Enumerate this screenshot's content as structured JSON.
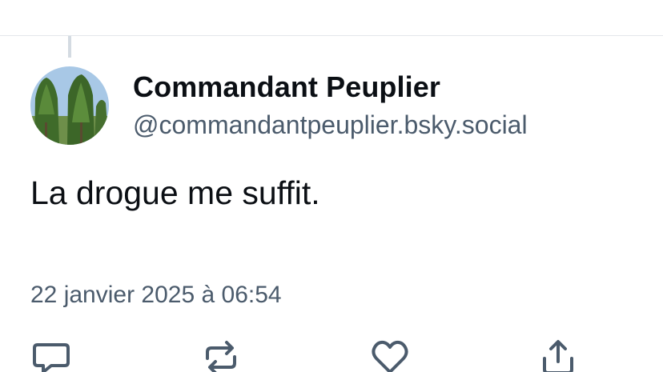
{
  "post": {
    "author": {
      "display_name": "Commandant Peuplier",
      "handle": "@commandantpeuplier.bsky.social",
      "avatar_icon": "poplar-trees-avatar"
    },
    "text": "La drogue me suffit.",
    "timestamp": "22 janvier 2025 à 06:54"
  },
  "actions": [
    {
      "name": "reply",
      "icon": "speech-bubble-icon"
    },
    {
      "name": "repost",
      "icon": "repost-arrows-icon"
    },
    {
      "name": "like",
      "icon": "heart-icon"
    },
    {
      "name": "share",
      "icon": "share-arrow-icon"
    }
  ],
  "colors": {
    "primary_text": "#0b0f14",
    "secondary_text": "#4b5b6c",
    "icon": "#4b5b6c",
    "divider": "#e3e7eb",
    "thread_line": "#d4dbe2"
  }
}
